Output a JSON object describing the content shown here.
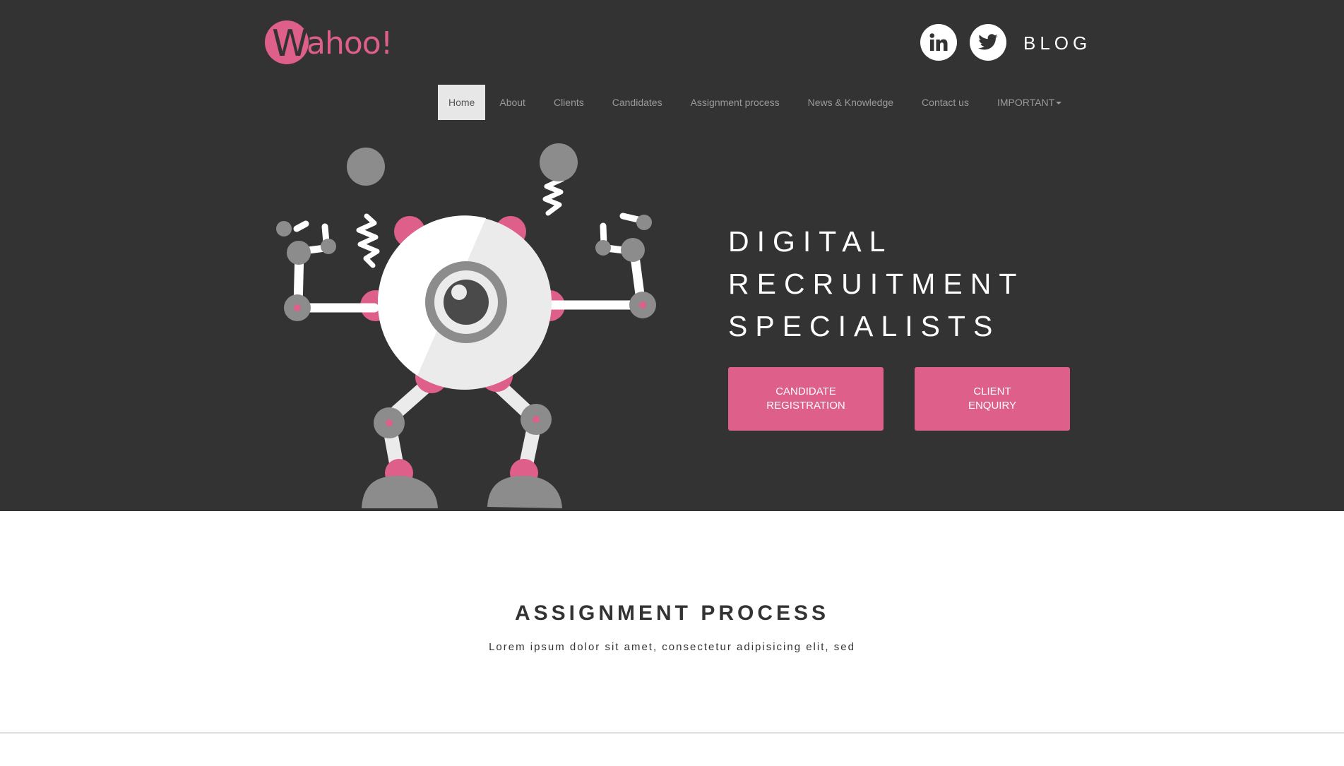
{
  "header": {
    "logo_text_first": "W",
    "logo_text_rest": "ahoo!",
    "linkedin_icon": "linkedin-icon",
    "twitter_icon": "twitter-icon",
    "blog_label": "BLOG"
  },
  "nav": {
    "items": [
      {
        "label": "Home",
        "active": true
      },
      {
        "label": "About"
      },
      {
        "label": "Clients"
      },
      {
        "label": "Candidates"
      },
      {
        "label": "Assignment process"
      },
      {
        "label": "News & Knowledge"
      },
      {
        "label": "Contact us"
      },
      {
        "label": "IMPORTANT",
        "dropdown": true
      }
    ]
  },
  "hero": {
    "headline_lines": [
      "DIGITAL",
      "RECRUITMENT",
      "SPECIALISTS"
    ],
    "candidate_button": [
      "CANDIDATE",
      "REGISTRATION"
    ],
    "client_button": [
      "CLIENT",
      "ENQUIRY"
    ]
  },
  "section": {
    "title": "ASSIGNMENT PROCESS",
    "subtitle": "Lorem ipsum dolor sit amet, consectetur adipisicing elit, sed"
  },
  "colors": {
    "hero_background": "#333333",
    "accent_pink": "#dd5f8a",
    "robot_gray": "#8c8c8c",
    "robot_white": "#ebebeb"
  }
}
